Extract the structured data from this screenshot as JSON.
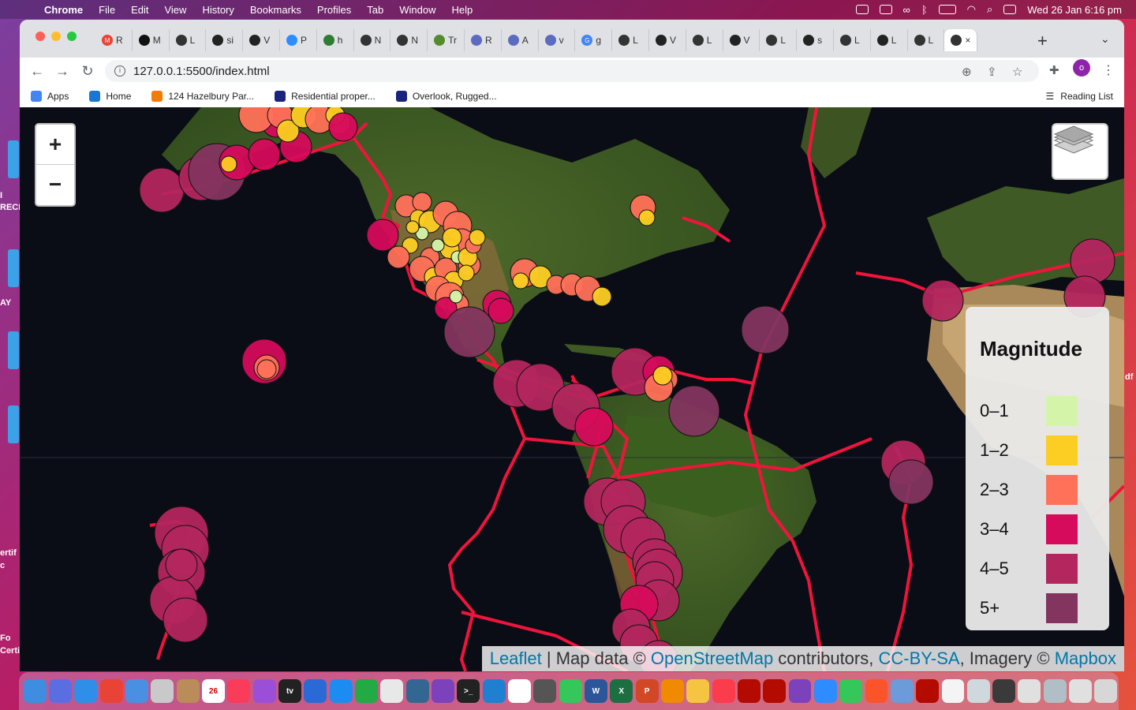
{
  "menubar": {
    "app": "Chrome",
    "items": [
      "File",
      "Edit",
      "View",
      "History",
      "Bookmarks",
      "Profiles",
      "Tab",
      "Window",
      "Help"
    ],
    "datetime": "Wed 26 Jan  6:16 pm"
  },
  "desktop": {
    "left_labels": [
      "I",
      "RECI",
      "AY",
      "ertif",
      "c",
      "Fo",
      "Certi"
    ],
    "right_labels": [
      "df"
    ]
  },
  "browser": {
    "tabs": [
      {
        "icon": "M",
        "label": "R",
        "color": "#ea4335"
      },
      {
        "icon": "",
        "label": "M",
        "color": "#111"
      },
      {
        "icon": "",
        "label": "L",
        "color": "#333"
      },
      {
        "icon": "",
        "label": "si",
        "color": "#222"
      },
      {
        "icon": "",
        "label": "V",
        "color": "#222"
      },
      {
        "icon": "",
        "label": "P",
        "color": "#2d8cff"
      },
      {
        "icon": "",
        "label": "h",
        "color": "#2e7d32"
      },
      {
        "icon": "",
        "label": "N",
        "color": "#333"
      },
      {
        "icon": "",
        "label": "N",
        "color": "#333"
      },
      {
        "icon": "",
        "label": "Tr",
        "color": "#558b2f"
      },
      {
        "icon": "",
        "label": "R",
        "color": "#5c6bc0"
      },
      {
        "icon": "",
        "label": "A",
        "color": "#5c6bc0"
      },
      {
        "icon": "",
        "label": "v",
        "color": "#5c6bc0"
      },
      {
        "icon": "G",
        "label": "g",
        "color": "#4285f4"
      },
      {
        "icon": "",
        "label": "L",
        "color": "#333"
      },
      {
        "icon": "",
        "label": "V",
        "color": "#222"
      },
      {
        "icon": "",
        "label": "L",
        "color": "#333"
      },
      {
        "icon": "",
        "label": "V",
        "color": "#222"
      },
      {
        "icon": "",
        "label": "L",
        "color": "#333"
      },
      {
        "icon": "",
        "label": "s",
        "color": "#222"
      },
      {
        "icon": "",
        "label": "L",
        "color": "#333"
      },
      {
        "icon": "",
        "label": "L",
        "color": "#222"
      },
      {
        "icon": "",
        "label": "L",
        "color": "#333"
      },
      {
        "icon": "",
        "label": "L",
        "color": "#333"
      }
    ],
    "active_tab_close": "×",
    "new_tab": "+",
    "url": "127.0.0.1:5500/index.html",
    "profile_initial": "o",
    "bookmarks": [
      {
        "label": "Apps",
        "color": "#4285f4"
      },
      {
        "label": "Home",
        "color": "#1976d2"
      },
      {
        "label": "124 Hazelbury Par...",
        "color": "#f57c00"
      },
      {
        "label": "Residential proper...",
        "color": "#1a237e"
      },
      {
        "label": "Overlook, Rugged...",
        "color": "#1a237e"
      }
    ],
    "reading_list": "Reading List"
  },
  "map": {
    "zoom_in": "+",
    "zoom_out": "−",
    "legend": {
      "title": "Magnitude",
      "items": [
        {
          "label": "0–1",
          "color": "#d4f5a9"
        },
        {
          "label": "1–2",
          "color": "#fccd22"
        },
        {
          "label": "2–3",
          "color": "#ff7158"
        },
        {
          "label": "3–4",
          "color": "#d60b5b"
        },
        {
          "label": "4–5",
          "color": "#b3265e"
        },
        {
          "label": "5+",
          "color": "#83355f"
        }
      ]
    },
    "attribution": {
      "leaflet": "Leaflet",
      "sep": " | Map data © ",
      "osm": "OpenStreetMap",
      "contrib": " contributors, ",
      "license": "CC-BY-SA",
      "imagery": ", Imagery © ",
      "mapbox": "Mapbox"
    },
    "plate_line_color": "#f0143c"
  },
  "dock": {
    "apps": [
      {
        "name": "finder",
        "color": "#3d8de0",
        "label": ""
      },
      {
        "name": "launchpad",
        "color": "#5b6ee1",
        "label": ""
      },
      {
        "name": "safari",
        "color": "#2f8fe8",
        "label": ""
      },
      {
        "name": "chrome",
        "color": "#e94335",
        "label": ""
      },
      {
        "name": "mail",
        "color": "#4a90e2",
        "label": ""
      },
      {
        "name": "system-prefs",
        "color": "#c9c9c9",
        "label": ""
      },
      {
        "name": "contacts",
        "color": "#b98c5a",
        "label": ""
      },
      {
        "name": "calendar",
        "color": "#ffffff",
        "label": "26"
      },
      {
        "name": "music",
        "color": "#fa3c5a",
        "label": ""
      },
      {
        "name": "podcasts",
        "color": "#9b4fd6",
        "label": ""
      },
      {
        "name": "tv",
        "color": "#222222",
        "label": "tv"
      },
      {
        "name": "quicktime",
        "color": "#2a6ad6",
        "label": ""
      },
      {
        "name": "app-store",
        "color": "#1d8cf0",
        "label": ""
      },
      {
        "name": "activity",
        "color": "#22aa44",
        "label": ""
      },
      {
        "name": "slack",
        "color": "#e8e8e8",
        "label": ""
      },
      {
        "name": "postgres",
        "color": "#336791",
        "label": ""
      },
      {
        "name": "github-desktop",
        "color": "#7b42bc",
        "label": ""
      },
      {
        "name": "terminal",
        "color": "#222222",
        "label": ">_"
      },
      {
        "name": "vscode",
        "color": "#1f7fd1",
        "label": ""
      },
      {
        "name": "mongodb",
        "color": "#ffffff",
        "label": ""
      },
      {
        "name": "omni",
        "color": "#555555",
        "label": ""
      },
      {
        "name": "messages",
        "color": "#34c759",
        "label": ""
      },
      {
        "name": "word",
        "color": "#2b579a",
        "label": "W"
      },
      {
        "name": "excel",
        "color": "#1d6f42",
        "label": "X"
      },
      {
        "name": "powerpoint",
        "color": "#d24726",
        "label": "P"
      },
      {
        "name": "vlc",
        "color": "#f08a00",
        "label": ""
      },
      {
        "name": "photos",
        "color": "#f5c542",
        "label": ""
      },
      {
        "name": "news",
        "color": "#fa3c4c",
        "label": ""
      },
      {
        "name": "acrobat",
        "color": "#b30b00",
        "label": ""
      },
      {
        "name": "acrobat-2",
        "color": "#b30b00",
        "label": ""
      },
      {
        "name": "github-2",
        "color": "#7b42bc",
        "label": ""
      },
      {
        "name": "zoom",
        "color": "#2d8cff",
        "label": ""
      },
      {
        "name": "facetime",
        "color": "#34c759",
        "label": ""
      },
      {
        "name": "brave",
        "color": "#fb542b",
        "label": ""
      },
      {
        "name": "preview",
        "color": "#6b9bd8",
        "label": ""
      },
      {
        "name": "acrobat-3",
        "color": "#b30b00",
        "label": ""
      },
      {
        "name": "document",
        "color": "#f4f4f4",
        "label": ""
      },
      {
        "name": "screenshot-1",
        "color": "#cfd8dc",
        "label": ""
      },
      {
        "name": "screenshot-2",
        "color": "#3a3a3a",
        "label": ""
      },
      {
        "name": "screenshot-3",
        "color": "#e0e0e0",
        "label": ""
      },
      {
        "name": "screenshot-4",
        "color": "#b0bec5",
        "label": ""
      },
      {
        "name": "screenshot-5",
        "color": "#e0e0e0",
        "label": ""
      },
      {
        "name": "trash",
        "color": "#d7d7d7",
        "label": ""
      }
    ]
  }
}
